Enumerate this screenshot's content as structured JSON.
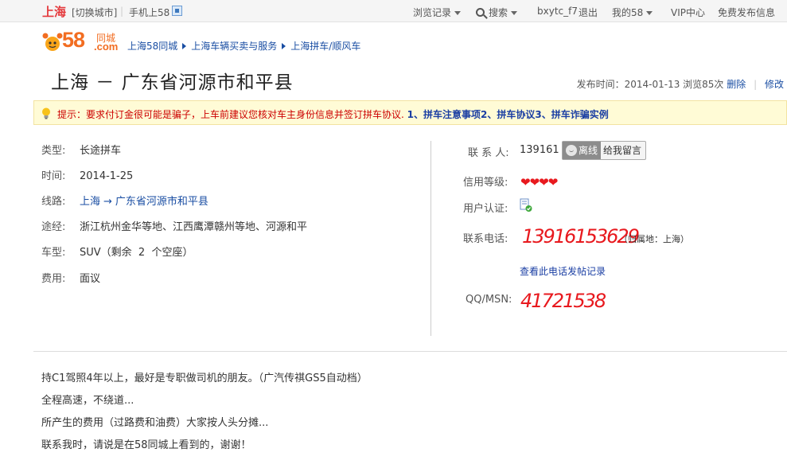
{
  "topbar": {
    "city": "上海",
    "switch_city": "[切换城市]",
    "mobile": "手机上58",
    "history": "浏览记录",
    "search": "搜索",
    "username": "bxytc_f7",
    "logout": "退出",
    "my58": "我的58",
    "vip": "VIP中心",
    "free_post": "免费发布信息"
  },
  "logo": {
    "brand": "58",
    "tongcheng": "同城",
    "dotcom": ".com"
  },
  "breadcrumb": [
    "上海58同城",
    "上海车辆买卖与服务",
    "上海拼车/顺风车"
  ],
  "title": "上海 － 广东省河源市和平县",
  "meta": {
    "published": "发布时间：2014-01-13 浏览85次",
    "delete": "删除",
    "modify": "修改"
  },
  "warning": {
    "text": "提示：要求付订金很可能是骗子，上车前建议您核对车主身份信息并签订拼车协议.",
    "links": "1、拼车注意事项2、拼车协议3、拼车诈骗实例"
  },
  "details": {
    "type_label": "类型:",
    "type_value": "长途拼车",
    "time_label": "时间:",
    "time_value": "2014-1-25",
    "route_label": "线路:",
    "route_from": "上海",
    "route_arrow": "→",
    "route_to": "广东省河源市和平县",
    "via_label": "途经:",
    "via_value": "浙江杭州金华等地、江西鹰潭赣州等地、河源和平",
    "car_label": "车型:",
    "car_value": "SUV（剩余  2  个空座）",
    "fee_label": "费用:",
    "fee_value": "面议"
  },
  "contact": {
    "person_label": "联 系 人:",
    "person_value": "139161",
    "offline": "离线",
    "leave_message": "给我留言",
    "credit_label": "信用等级:",
    "credit_hearts": "❤❤❤❤",
    "verify_label": "用户认证:",
    "phone_label": "联系电话:",
    "phone_value": "13916153629",
    "phone_location": "（归属地：上海）",
    "call_log": "查看此电话发帖记录",
    "qq_label": "QQ/MSN:",
    "qq_value": "41721538"
  },
  "description": [
    "持C1驾照4年以上，最好是专职做司机的朋友。（广汽传祺GS5自动档）",
    "全程高速，不绕道...",
    "所产生的费用（过路费和油费）大家按人头分摊...",
    "联系我时，请说是在58同城上看到的，谢谢！"
  ],
  "colors": {
    "brand_orange": "#f26d21",
    "link_blue": "#1a4ea3",
    "alert_red": "#e8191e",
    "warning_bg": "#fffbd6"
  }
}
